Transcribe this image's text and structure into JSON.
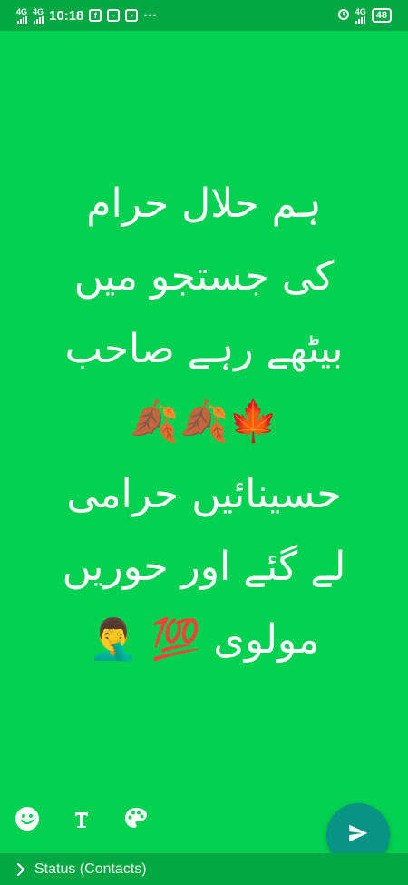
{
  "status_bar": {
    "network_left_1": "4G",
    "network_left_2": "4G",
    "time": "10:18",
    "more": "···",
    "network_right": "4G",
    "battery": "48"
  },
  "status_post": {
    "lines": [
      "ہم حلال حرام",
      "کی جستجو میں",
      "بیٹھے رہے صاحب",
      "🍁🍂🍂",
      "حسینائیں حرامی",
      "لے گئے اور حوریں",
      "مولوی 💯 🤦‍♂️"
    ]
  },
  "audience": {
    "label": "Status (Contacts)"
  },
  "colors": {
    "background": "#05D150",
    "bars": "#03A744",
    "send_button": "#089485"
  }
}
